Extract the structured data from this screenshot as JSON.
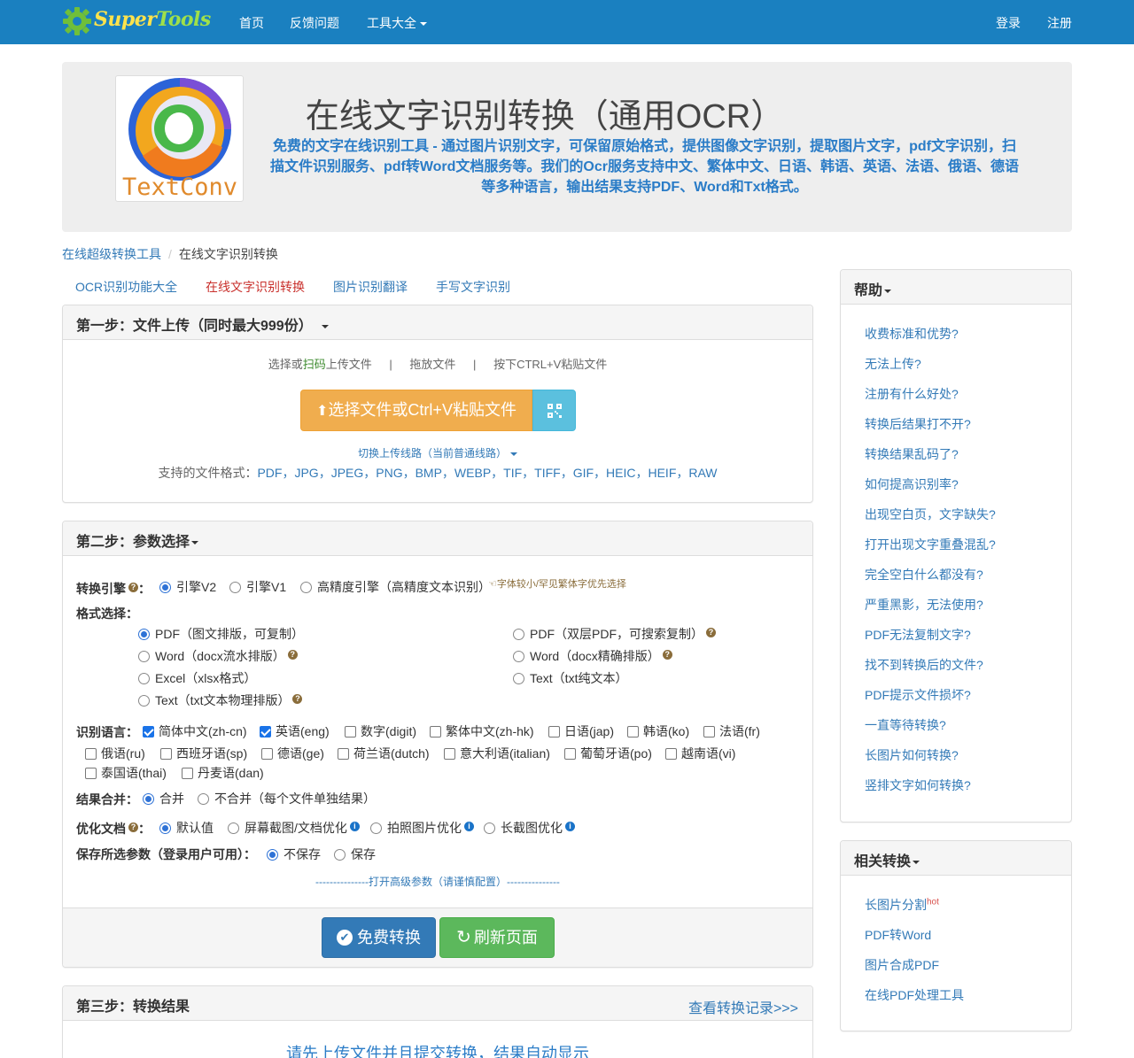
{
  "nav": {
    "brand_part1": "Super",
    "brand_part2": "Tools",
    "links": [
      "首页",
      "反馈问题",
      "工具大全"
    ],
    "login": "登录",
    "register": "注册"
  },
  "hero": {
    "logo_text": "TextConv",
    "title": "在线文字识别转换（通用OCR）",
    "lead": "免费的文字在线识别工具 - 通过图片识别文字，可保留原始格式，提供图像文字识别，提取图片文字，pdf文字识别，扫描文件识别服务、pdf转Word文档服务等。我们的Ocr服务支持中文、繁体中文、日语、韩语、英语、法语、俄语、德语等多种语言，输出结果支持PDF、Word和Txt格式。"
  },
  "breadcrumb": {
    "home": "在线超级转换工具",
    "current": "在线文字识别转换"
  },
  "tabs": [
    "OCR识别功能大全",
    "在线文字识别转换",
    "图片识别翻译",
    "手写文字识别"
  ],
  "step1": {
    "title": "第一步：文件上传（同时最大999份）",
    "hint_a": "选择或",
    "hint_scan": "扫码",
    "hint_b": "上传文件",
    "hint_sep": "|",
    "hint_drag": "拖放文件",
    "hint_paste": "按下CTRL+V粘贴文件",
    "upload_button": "选择文件或Ctrl+V粘贴文件",
    "switch_line": "切换上传线路（当前普通线路）",
    "formats_label": "支持的文件格式：",
    "formats": "PDF，JPG，JPEG，PNG，BMP，WEBP，TIF，TIFF，GIF，HEIC，HEIF，RAW"
  },
  "step2": {
    "title": "第二步：参数选择",
    "engine_label": "转换引擎",
    "engine_colon": "：",
    "engines": [
      "引擎V2",
      "引擎V1",
      "高精度引擎（高精度文本识别）"
    ],
    "engine_tip": "字体较小/罕见繁体字优先选择",
    "format_label": "格式选择：",
    "formats_left": [
      "PDF（图文排版，可复制）",
      "Word（docx流水排版）",
      "Excel（xlsx格式）",
      "Text（txt文本物理排版）"
    ],
    "formats_right": [
      "PDF（双层PDF，可搜索复制）",
      "Word（docx精确排版）",
      "Text（txt纯文本）"
    ],
    "lang_label": "识别语言：",
    "langs_row1": [
      "简体中文(zh-cn)",
      "英语(eng)",
      "数字(digit)",
      "繁体中文(zh-hk)",
      "日语(jap)",
      "韩语(ko)",
      "法语(fr)"
    ],
    "langs_row2": [
      "俄语(ru)",
      "西班牙语(sp)",
      "德语(ge)",
      "荷兰语(dutch)",
      "意大利语(italian)",
      "葡萄牙语(po)",
      "越南语(vi)"
    ],
    "langs_row3": [
      "泰国语(thai)",
      "丹麦语(dan)"
    ],
    "merge_label": "结果合并：",
    "merge_opts": [
      "合并",
      "不合并（每个文件单独结果）"
    ],
    "optimize_label": "优化文档",
    "optimize_colon": "：",
    "optimize_opts": [
      "默认值",
      "屏幕截图/文档优化",
      "拍照图片优化",
      "长截图优化"
    ],
    "save_label": "保存所选参数（登录用户可用）：",
    "save_opts": [
      "不保存",
      "保存"
    ],
    "advanced": "---------------打开高级参数（请谨慎配置）---------------",
    "convert_button": "免费转换",
    "refresh_button": "刷新页面"
  },
  "step3": {
    "title": "第三步：转换结果",
    "history_link": "查看转换记录>>>",
    "placeholder": "请先上传文件并且提交转换，结果自动显示"
  },
  "help": {
    "title": "帮助",
    "items": [
      "收费标准和优势?",
      "无法上传?",
      "注册有什么好处?",
      "转换后结果打不开?",
      "转换结果乱码了?",
      "如何提高识别率?",
      "出现空白页，文字缺失?",
      "打开出现文字重叠混乱?",
      "完全空白什么都没有?",
      "严重黑影，无法使用?",
      "PDF无法复制文字?",
      "找不到转换后的文件?",
      "PDF提示文件损坏?",
      "一直等待转换?",
      "长图片如何转换?",
      "竖排文字如何转换?"
    ]
  },
  "related": {
    "title": "相关转换",
    "items": [
      "长图片分割",
      "PDF转Word",
      "图片合成PDF",
      "在线PDF处理工具"
    ],
    "hot": "hot"
  },
  "colors": {
    "nav_bg": "#1a80c0",
    "upload_orange": "#f0ad4e",
    "qr_blue": "#5bc0de",
    "convert_blue": "#337ab7",
    "refresh_green": "#5cb85c",
    "active_tab": "#c9302c"
  }
}
